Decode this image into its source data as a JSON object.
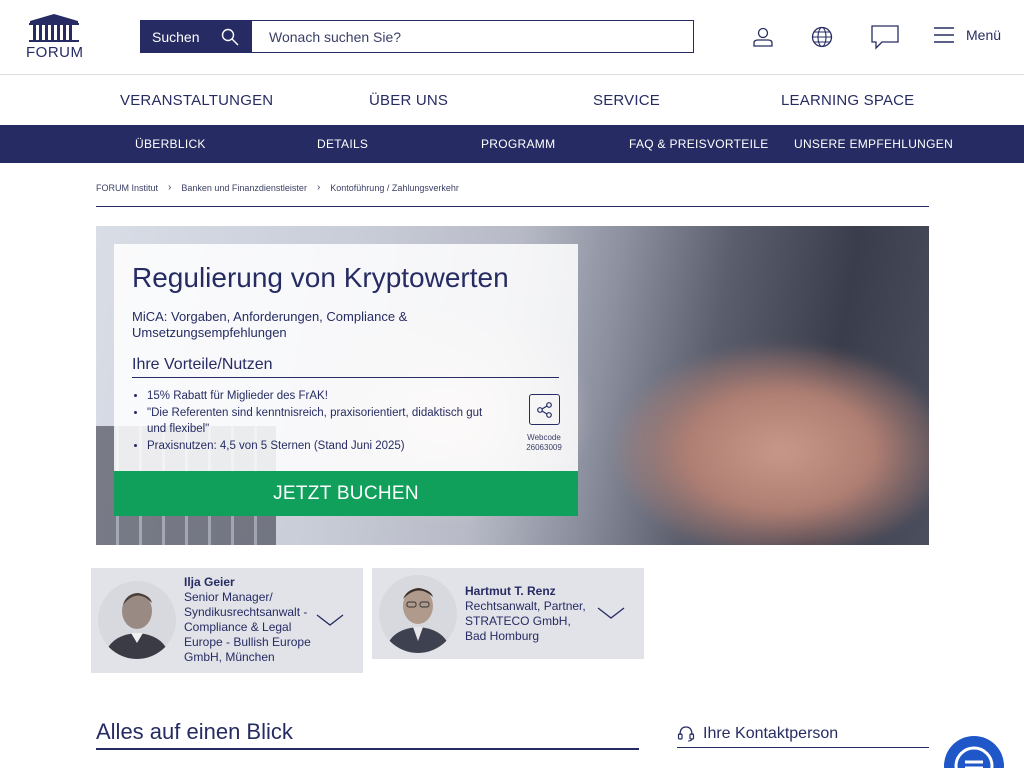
{
  "header": {
    "logo_text": "FORUM",
    "search": {
      "button_label": "Suchen",
      "placeholder": "Wonach suchen Sie?",
      "value": ""
    },
    "menu_label": "Menü",
    "icons": [
      "user-icon",
      "globe-icon",
      "chat-bubble-icon",
      "hamburger-icon"
    ]
  },
  "main_nav": [
    "VERANSTALTUNGEN",
    "ÜBER UNS",
    "SERVICE",
    "LEARNING SPACE"
  ],
  "sub_nav": [
    "ÜBERBLICK",
    "DETAILS",
    "PROGRAMM",
    "FAQ & PREISVORTEILE",
    "UNSERE EMPFEHLUNGEN"
  ],
  "breadcrumb": [
    "FORUM Institut",
    "Banken und Finanzdienstleister",
    "Kontoführung / Zahlungsverkehr"
  ],
  "hero": {
    "title": "Regulierung von Kryptowerten",
    "subtitle": "MiCA: Vorgaben, Anforderungen, Compliance & Umsetzungsempfehlungen",
    "benefits_heading": "Ihre Vorteile/Nutzen",
    "benefits": [
      "15% Rabatt für Miglieder des FrAK!",
      "\"Die Referenten sind kenntnisreich, praxisorientiert, didaktisch gut und flexibel\"",
      "Praxisnutzen: 4,5 von 5 Sternen (Stand Juni 2025)"
    ],
    "webcode_label": "Webcode",
    "webcode": "26063009",
    "cta": "JETZT BUCHEN"
  },
  "speakers": [
    {
      "name": "Ilja Geier",
      "description": "Senior Manager/ Syndikusrechtsanwalt - Compliance & Legal Europe - Bullish Europe GmbH, München"
    },
    {
      "name": "Hartmut T. Renz",
      "description": "Rechtsanwalt, Partner, STRATECO GmbH, Bad Homburg"
    }
  ],
  "sections": {
    "overview_title": "Alles auf einen Blick",
    "contact_title": "Ihre Kontaktperson"
  },
  "colors": {
    "navy": "#262c63",
    "green": "#10a05c",
    "chat_blue": "#1f57c9",
    "panel_gray": "#e2e3e8"
  }
}
